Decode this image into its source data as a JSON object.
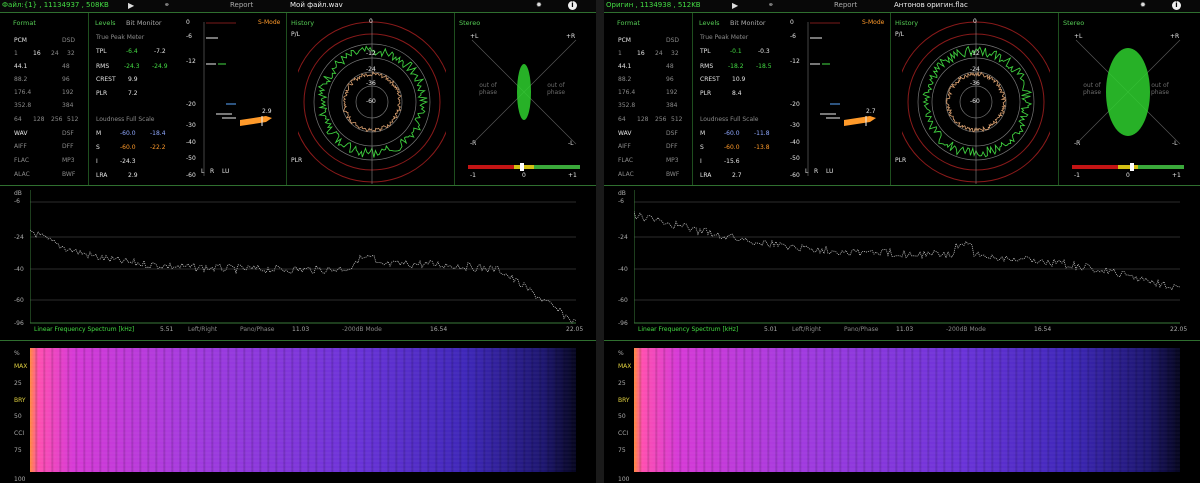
{
  "left": {
    "file_info": "Файл:{1}  , 11134937 , 508KB",
    "report_label": "Report",
    "filename": "Мой файл.wav",
    "format": {
      "title": "Format",
      "rows": [
        [
          "PCM",
          "DSD"
        ],
        [
          "1",
          "16",
          "24",
          "32"
        ],
        [
          "44.1",
          "48"
        ],
        [
          "88.2",
          "96"
        ],
        [
          "176.4",
          "192"
        ],
        [
          "352.8",
          "384"
        ],
        [
          "64",
          "128",
          "256",
          "512"
        ],
        [
          "WAV",
          "DSF"
        ],
        [
          "AIFF",
          "DFF"
        ],
        [
          "FLAC",
          "MP3"
        ],
        [
          "ALAC",
          "BWF"
        ]
      ]
    },
    "levels": {
      "title": "Levels",
      "bit_monitor": "Bit Monitor",
      "true_peak": "True Peak Meter",
      "tpl_label": "TPL",
      "tpl_l": "-6.4",
      "tpl_r": "-7.2",
      "rms_label": "RMS",
      "rms_l": "-24.3",
      "rms_r": "-24.9",
      "crest_label": "CREST",
      "crest": "9.9",
      "plr_label": "PLR",
      "plr": "7.2",
      "loudness_title": "Loudness Full Scale",
      "m_label": "M",
      "m_a": "-60.0",
      "m_b": "-18.4",
      "s_label": "S",
      "s_a": "-60.0",
      "s_b": "-22.2",
      "i_label": "I",
      "i_val": "-24.3",
      "lra_label": "LRA",
      "lra": "2.9"
    },
    "smode": {
      "title": "S-Mode",
      "value": "2.9",
      "scale": [
        "0",
        "-6",
        "-12",
        "-20",
        "-30",
        "-40",
        "-50",
        "-60"
      ],
      "foot": [
        "L",
        "R",
        "LU"
      ]
    },
    "history": {
      "title": "History",
      "pl": "P/L",
      "plr": "PLR",
      "rings": [
        "0",
        "-12",
        "-24",
        "-36",
        "-60"
      ]
    },
    "stereo": {
      "title": "Stereo",
      "l": "+L",
      "r": "+R",
      "ml": "-R",
      "mr": "-L",
      "oop_l": "out of phase",
      "oop_r": "out of phase",
      "scale": [
        "-1",
        "0",
        "+1"
      ]
    },
    "spectrum": {
      "db_label": "dB",
      "y": [
        "-6",
        "-24",
        "-40",
        "-60",
        "-96"
      ],
      "title": "Linear Frequency Spectrum [kHz]",
      "x": [
        "5.51",
        "11.03",
        "16.54",
        "22.05"
      ],
      "modes": [
        "Left/Right",
        "Pano/Phase",
        "-200dB Mode"
      ]
    },
    "spectrogram": {
      "labels": [
        "%",
        "MAX",
        "25",
        "BRY",
        "50",
        "CCI",
        "75",
        "100"
      ]
    }
  },
  "right": {
    "file_info": "Оригин , 1134938 , 512KB",
    "report_label": "Report",
    "filename": "Антонов оригин.flac",
    "format": {
      "title": "Format",
      "rows": [
        [
          "PCM",
          "DSD"
        ],
        [
          "1",
          "16",
          "24",
          "32"
        ],
        [
          "44.1",
          "48"
        ],
        [
          "88.2",
          "96"
        ],
        [
          "176.4",
          "192"
        ],
        [
          "352.8",
          "384"
        ],
        [
          "64",
          "128",
          "256",
          "512"
        ],
        [
          "WAV",
          "DSF"
        ],
        [
          "AIFF",
          "DFF"
        ],
        [
          "FLAC",
          "MP3"
        ],
        [
          "ALAC",
          "BWF"
        ]
      ]
    },
    "levels": {
      "title": "Levels",
      "bit_monitor": "Bit Monitor",
      "true_peak": "True Peak Meter",
      "tpl_label": "TPL",
      "tpl_l": "-0.1",
      "tpl_r": "-0.3",
      "rms_label": "RMS",
      "rms_l": "-18.2",
      "rms_r": "-18.5",
      "crest_label": "CREST",
      "crest": "10.9",
      "plr_label": "PLR",
      "plr": "8.4",
      "loudness_title": "Loudness Full Scale",
      "m_label": "M",
      "m_a": "-60.0",
      "m_b": "-11.8",
      "s_label": "S",
      "s_a": "-60.0",
      "s_b": "-13.8",
      "i_label": "I",
      "i_val": "-15.6",
      "lra_label": "LRA",
      "lra": "2.7"
    },
    "smode": {
      "title": "S-Mode",
      "value": "2.7",
      "scale": [
        "0",
        "-6",
        "-12",
        "-20",
        "-30",
        "-40",
        "-50",
        "-60"
      ],
      "foot": [
        "L",
        "R",
        "LU"
      ]
    },
    "history": {
      "title": "History",
      "pl": "P/L",
      "plr": "PLR",
      "rings": [
        "0",
        "-12",
        "-24",
        "-36",
        "-60"
      ]
    },
    "stereo": {
      "title": "Stereo",
      "l": "+L",
      "r": "+R",
      "ml": "-R",
      "mr": "-L",
      "oop_l": "out of phase",
      "oop_r": "out of phase",
      "scale": [
        "-1",
        "0",
        "+1"
      ]
    },
    "spectrum": {
      "db_label": "dB",
      "y": [
        "-6",
        "-24",
        "-40",
        "-60",
        "-96"
      ],
      "title": "Linear Frequency Spectrum [kHz]",
      "x": [
        "5.01",
        "11.03",
        "16.54",
        "22.05"
      ],
      "modes": [
        "Left/Right",
        "Pano/Phase",
        "-200dB Mode"
      ]
    },
    "spectrogram": {
      "labels": [
        "%",
        "MAX",
        "25",
        "BRY",
        "50",
        "CCI",
        "75",
        "100"
      ]
    }
  },
  "colors": {
    "accent_green": "#44dd44",
    "peak_orange": "#ff9a2a",
    "ring_red": "#8a1a1a"
  }
}
